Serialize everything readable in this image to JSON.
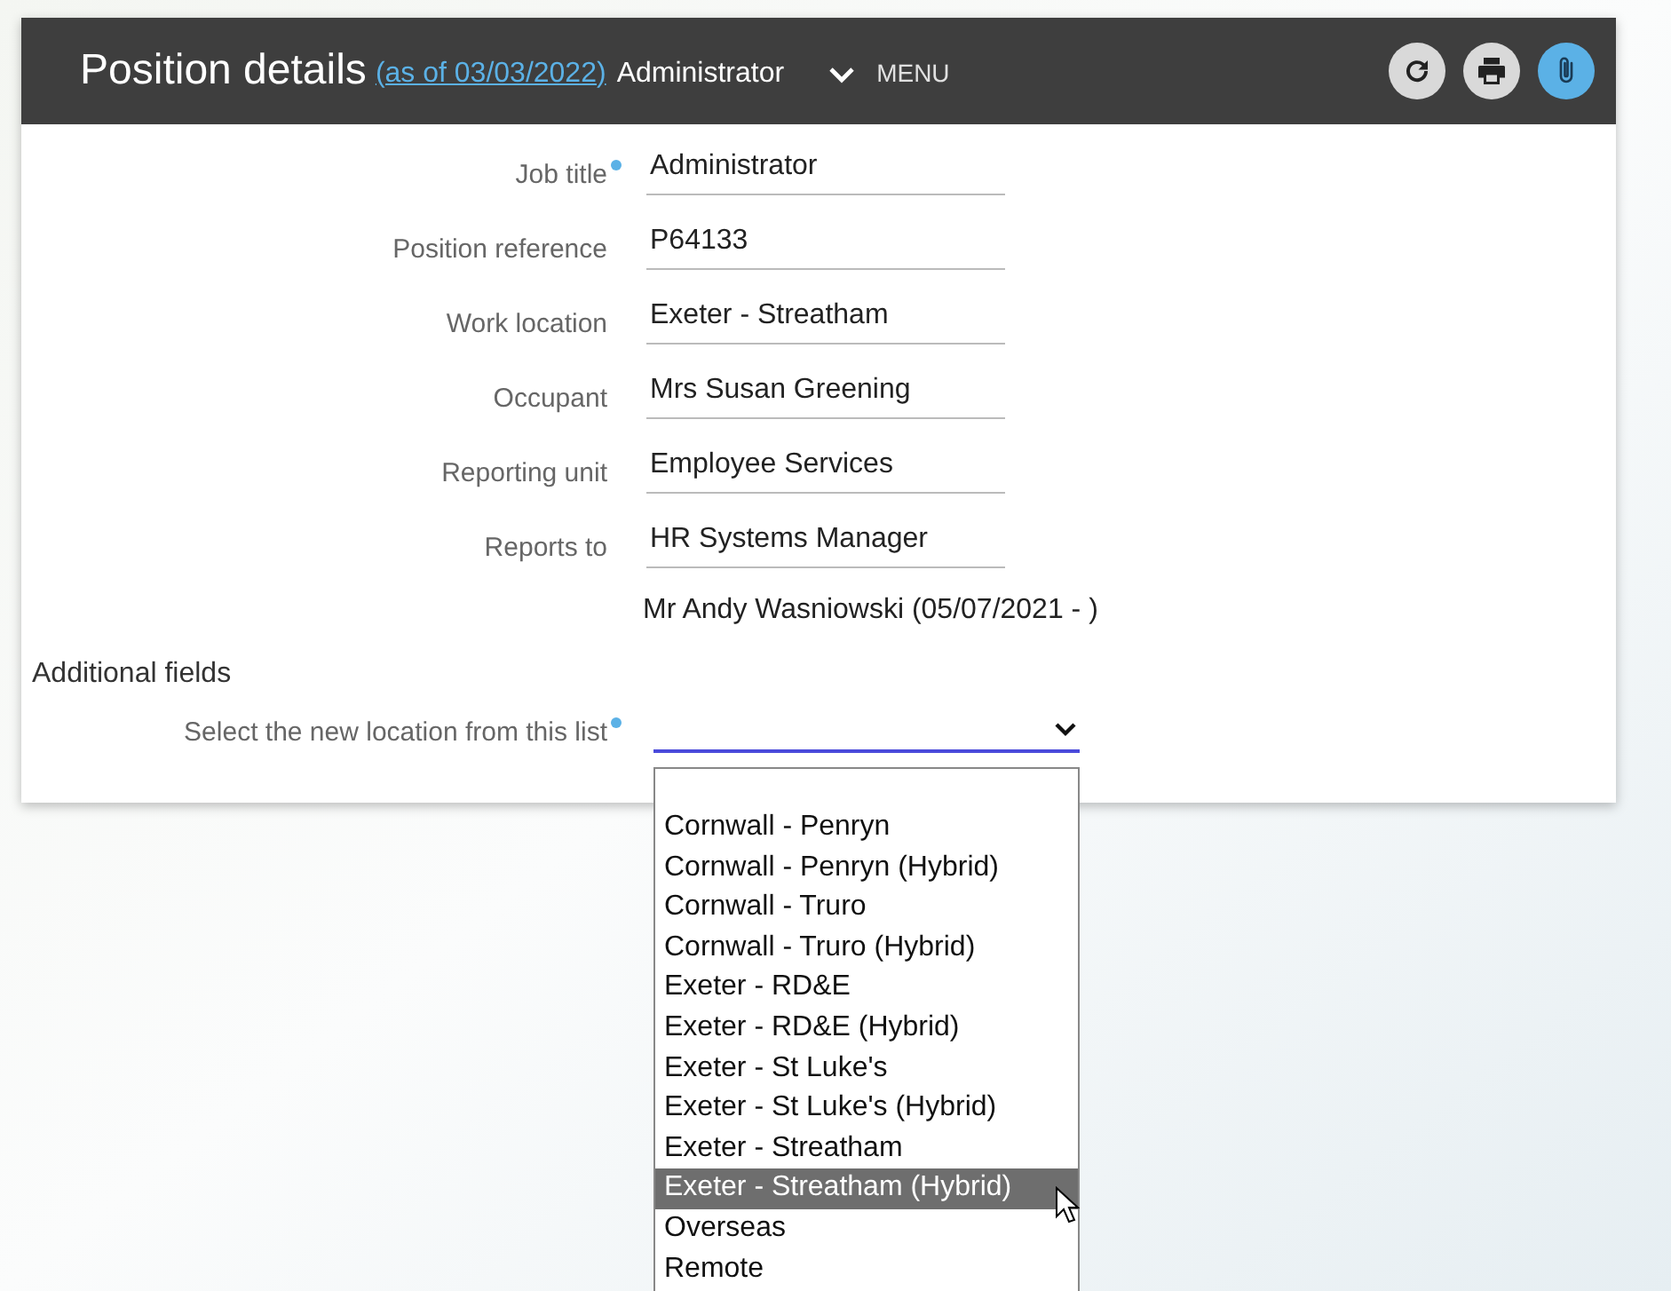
{
  "header": {
    "title": "Position details",
    "as_of_link": "(as of 03/03/2022)",
    "subtitle": "Administrator",
    "menu_label": "MENU"
  },
  "fields": [
    {
      "label": "Job title",
      "required": true,
      "value": "Administrator"
    },
    {
      "label": "Position reference",
      "required": false,
      "value": "P64133"
    },
    {
      "label": "Work location",
      "required": false,
      "value": "Exeter - Streatham"
    },
    {
      "label": "Occupant",
      "required": false,
      "value": "Mrs Susan Greening"
    },
    {
      "label": "Reporting unit",
      "required": false,
      "value": "Employee Services"
    },
    {
      "label": "Reports to",
      "required": false,
      "value": "HR Systems Manager"
    }
  ],
  "reports_to_person": "Mr Andy Wasniowski (05/07/2021 - )",
  "additional_fields": {
    "heading": "Additional fields",
    "select_label": "Select the new location from this list",
    "required": true,
    "options": [
      {
        "label": "Cornwall - Penryn",
        "selected": false
      },
      {
        "label": "Cornwall - Penryn (Hybrid)",
        "selected": false
      },
      {
        "label": "Cornwall - Truro",
        "selected": false
      },
      {
        "label": "Cornwall - Truro (Hybrid)",
        "selected": false
      },
      {
        "label": "Exeter - RD&E",
        "selected": false
      },
      {
        "label": "Exeter - RD&E (Hybrid)",
        "selected": false
      },
      {
        "label": "Exeter - St Luke's",
        "selected": false
      },
      {
        "label": "Exeter - St Luke's (Hybrid)",
        "selected": false
      },
      {
        "label": "Exeter - Streatham",
        "selected": false
      },
      {
        "label": "Exeter - Streatham (Hybrid)",
        "selected": true
      },
      {
        "label": "Overseas",
        "selected": false
      },
      {
        "label": "Remote",
        "selected": false
      }
    ]
  }
}
